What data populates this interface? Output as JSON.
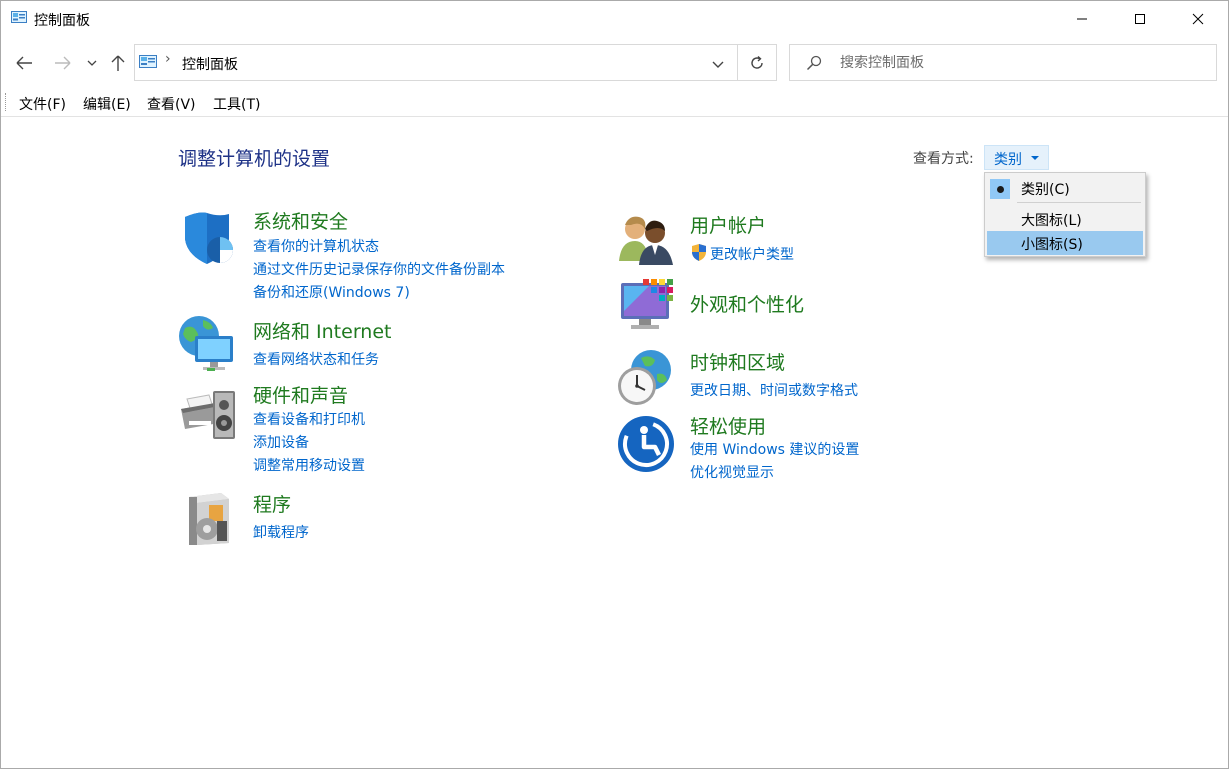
{
  "window": {
    "title": "控制面板"
  },
  "address": {
    "location": "控制面板",
    "search_placeholder": "搜索控制面板"
  },
  "menu": [
    "文件(F)",
    "编辑(E)",
    "查看(V)",
    "工具(T)"
  ],
  "page": {
    "heading": "调整计算机的设置",
    "view_by_label": "查看方式:",
    "view_by_value": "类别"
  },
  "categories_left": [
    {
      "title": "系统和安全",
      "links": [
        "查看你的计算机状态",
        "通过文件历史记录保存你的文件备份副本",
        "备份和还原(Windows 7)"
      ]
    },
    {
      "title": "网络和 Internet",
      "links": [
        "查看网络状态和任务"
      ]
    },
    {
      "title": "硬件和声音",
      "links": [
        "查看设备和打印机",
        "添加设备",
        "调整常用移动设置"
      ]
    },
    {
      "title": "程序",
      "links": [
        "卸载程序"
      ]
    }
  ],
  "categories_right": [
    {
      "title": "用户帐户",
      "links": [
        "更改帐户类型"
      ]
    },
    {
      "title": "外观和个性化",
      "links": []
    },
    {
      "title": "时钟和区域",
      "links": [
        "更改日期、时间或数字格式"
      ]
    },
    {
      "title": "轻松使用",
      "links": [
        "使用 Windows 建议的设置",
        "优化视觉显示"
      ]
    }
  ],
  "view_menu": {
    "items": [
      "类别(C)",
      "大图标(L)",
      "小图标(S)"
    ],
    "selected": "类别(C)",
    "highlighted": "小图标(S)"
  },
  "colors": {
    "link": "#0066cc",
    "category_title": "#1f7a1f",
    "heading": "#1e3287",
    "menu_highlight": "#99c9ef"
  }
}
